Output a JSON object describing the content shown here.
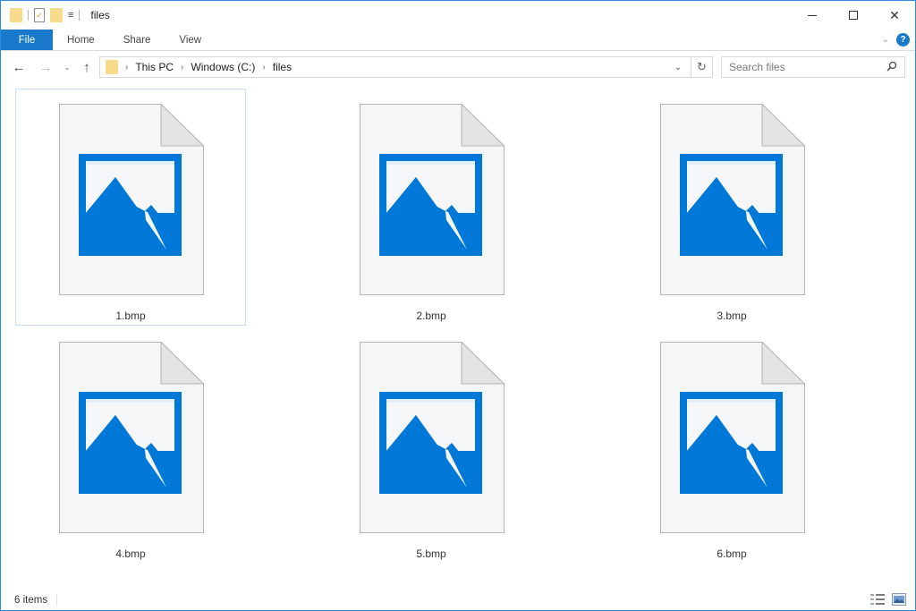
{
  "window": {
    "title": "files",
    "controls": {
      "minimize": "minimize",
      "maximize": "maximize",
      "close": "close"
    }
  },
  "quick_access_toolbar": {
    "icons": [
      "folder-icon",
      "properties-icon",
      "new-folder-icon",
      "customize-dropdown-icon"
    ]
  },
  "ribbon": {
    "tabs": [
      {
        "label": "File",
        "active": true
      },
      {
        "label": "Home"
      },
      {
        "label": "Share"
      },
      {
        "label": "View"
      }
    ],
    "help_label": "?"
  },
  "navigation": {
    "back": "←",
    "forward": "→",
    "recent": "⌄",
    "up": "↑",
    "breadcrumb": [
      "This PC",
      "Windows (C:)",
      "files"
    ],
    "refresh": "↻"
  },
  "search": {
    "placeholder": "Search files",
    "value": ""
  },
  "files": [
    {
      "name": "1.bmp",
      "selected": true
    },
    {
      "name": "2.bmp",
      "selected": false
    },
    {
      "name": "3.bmp",
      "selected": false
    },
    {
      "name": "4.bmp",
      "selected": false
    },
    {
      "name": "5.bmp",
      "selected": false
    },
    {
      "name": "6.bmp",
      "selected": false
    }
  ],
  "status": {
    "item_count": "6 items"
  },
  "colors": {
    "accent": "#1979ca",
    "image_icon_blue": "#0078d7",
    "folder_yellow": "#f8dc8c",
    "selection_border": "#c9e0f7"
  }
}
